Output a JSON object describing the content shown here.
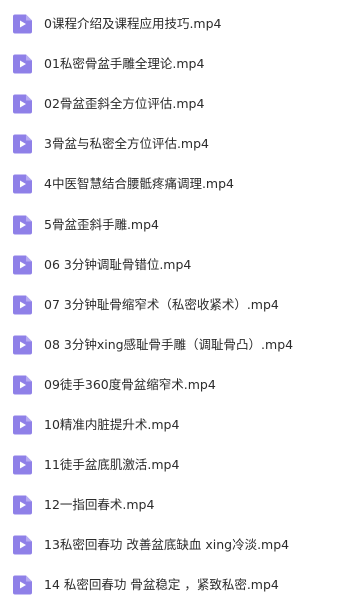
{
  "icon_name": "video-file-icon",
  "colors": {
    "icon_fill": "#8f80e8",
    "icon_play": "#ffffff",
    "text": "#2b2b2b",
    "background": "#ffffff"
  },
  "files": [
    {
      "name": "0课程介绍及课程应用技巧.mp4"
    },
    {
      "name": "01私密骨盆手雕全理论.mp4"
    },
    {
      "name": "02骨盆歪斜全方位评估.mp4"
    },
    {
      "name": "3骨盆与私密全方位评估.mp4"
    },
    {
      "name": "4中医智慧结合腰骶疼痛调理.mp4"
    },
    {
      "name": "5骨盆歪斜手雕.mp4"
    },
    {
      "name": "06 3分钟调耻骨错位.mp4"
    },
    {
      "name": "07 3分钟耻骨缩窄术（私密收紧术）.mp4"
    },
    {
      "name": "08 3分钟xing感耻骨手雕（调耻骨凸）.mp4"
    },
    {
      "name": "09徒手360度骨盆缩窄术.mp4"
    },
    {
      "name": "10精准内脏提升术.mp4"
    },
    {
      "name": "11徒手盆底肌激活.mp4"
    },
    {
      "name": "12一指回春术.mp4"
    },
    {
      "name": "13私密回春功 改善盆底缺血 xing冷淡.mp4"
    },
    {
      "name": "14 私密回春功 骨盆稳定 ，紧致私密.mp4"
    }
  ]
}
